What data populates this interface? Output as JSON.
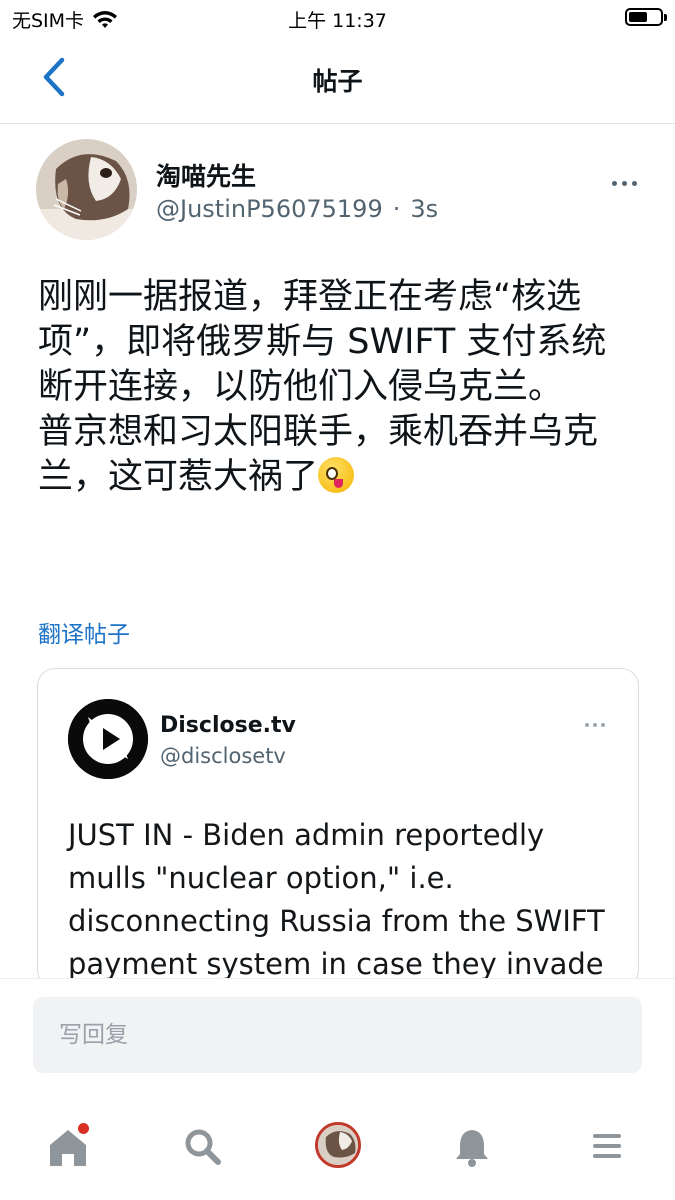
{
  "status_bar": {
    "carrier": "无SIM卡",
    "time": "上午 11:37"
  },
  "nav": {
    "title": "帖子"
  },
  "post": {
    "author_name": "淘喵先生",
    "handle": "@JustinP56075199",
    "separator": "·",
    "time_ago": "3s",
    "text": "刚刚一据报道，拜登正在考虑“核选项”，即将俄罗斯与 SWIFT 支付系统断开连接，以防他们入侵乌克兰。\n普京想和习太阳联手，乘机吞并乌克兰，这可惹大祸了",
    "emoji": "zany-face-emoji",
    "translate_label": "翻译帖子"
  },
  "quote": {
    "name": "Disclose.tv",
    "handle": "@disclosetv",
    "text": "JUST IN - Biden admin reportedly mulls \"nuclear option,\" i.e. disconnecting Russia from the SWIFT payment system in case they invade"
  },
  "reply": {
    "placeholder": "写回复"
  },
  "tabs": [
    {
      "name": "home-icon",
      "has_badge": true
    },
    {
      "name": "search-icon"
    },
    {
      "name": "profile-avatar"
    },
    {
      "name": "bell-icon"
    },
    {
      "name": "menu-icon"
    }
  ],
  "colors": {
    "link": "#1d74c7",
    "badge": "#d93025",
    "muted": "#536471"
  }
}
